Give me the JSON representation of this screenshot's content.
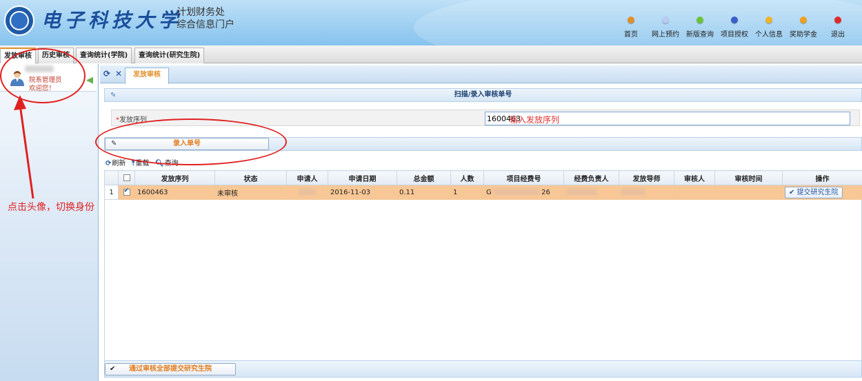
{
  "header": {
    "school_name": "电子科技大学",
    "system_line1": "计划财务处",
    "system_line2": "综合信息门户",
    "nav": [
      {
        "label": "首页",
        "color": "#e0902b",
        "icon": "home-dot-icon"
      },
      {
        "label": "网上预约",
        "color": "#b9c9f0",
        "icon": "appointment-dot-icon"
      },
      {
        "label": "新版查询",
        "color": "#6cc23a",
        "icon": "query-dot-icon"
      },
      {
        "label": "项目授权",
        "color": "#3b5fc9",
        "icon": "auth-dot-icon"
      },
      {
        "label": "个人信息",
        "color": "#f0b429",
        "icon": "profile-dot-icon"
      },
      {
        "label": "奖助学金",
        "color": "#f0a020",
        "icon": "scholarship-dot-icon"
      },
      {
        "label": "退出",
        "color": "#e02a2a",
        "icon": "logout-dot-icon"
      }
    ]
  },
  "main_tabs": [
    "发放审核",
    "历史审核",
    "查询统计(学院)",
    "查询统计(研究生院)"
  ],
  "user": {
    "role": "院系管理员",
    "welcome": "欢迎您！"
  },
  "content": {
    "tab_label": "发放审核",
    "panel_title": "扫描/录入审核单号",
    "field_label": "发放序列",
    "field_required_mark": "*",
    "serial_value": "1600463",
    "enter_button": "录入单号",
    "toolbar": {
      "refresh": "刷新",
      "reload": "重载",
      "query": "查询"
    },
    "columns": [
      "发放序列",
      "状态",
      "申请人",
      "申请日期",
      "总金额",
      "人数",
      "项目经费号",
      "经费负责人",
      "发放导师",
      "审核人",
      "审核时间",
      "操作"
    ],
    "rows": [
      {
        "index": "1",
        "serial": "1600463",
        "status": "未审核",
        "date": "2016-11-03",
        "amount": "0.11",
        "count": "1",
        "project_prefix": "G",
        "project_suffix": "26",
        "action": "提交研究生院"
      }
    ],
    "pass_all_button": "通过审核全部提交研究生院"
  },
  "annotations": {
    "hint": "输入发放序列",
    "note": "点击头像，切换身份"
  }
}
